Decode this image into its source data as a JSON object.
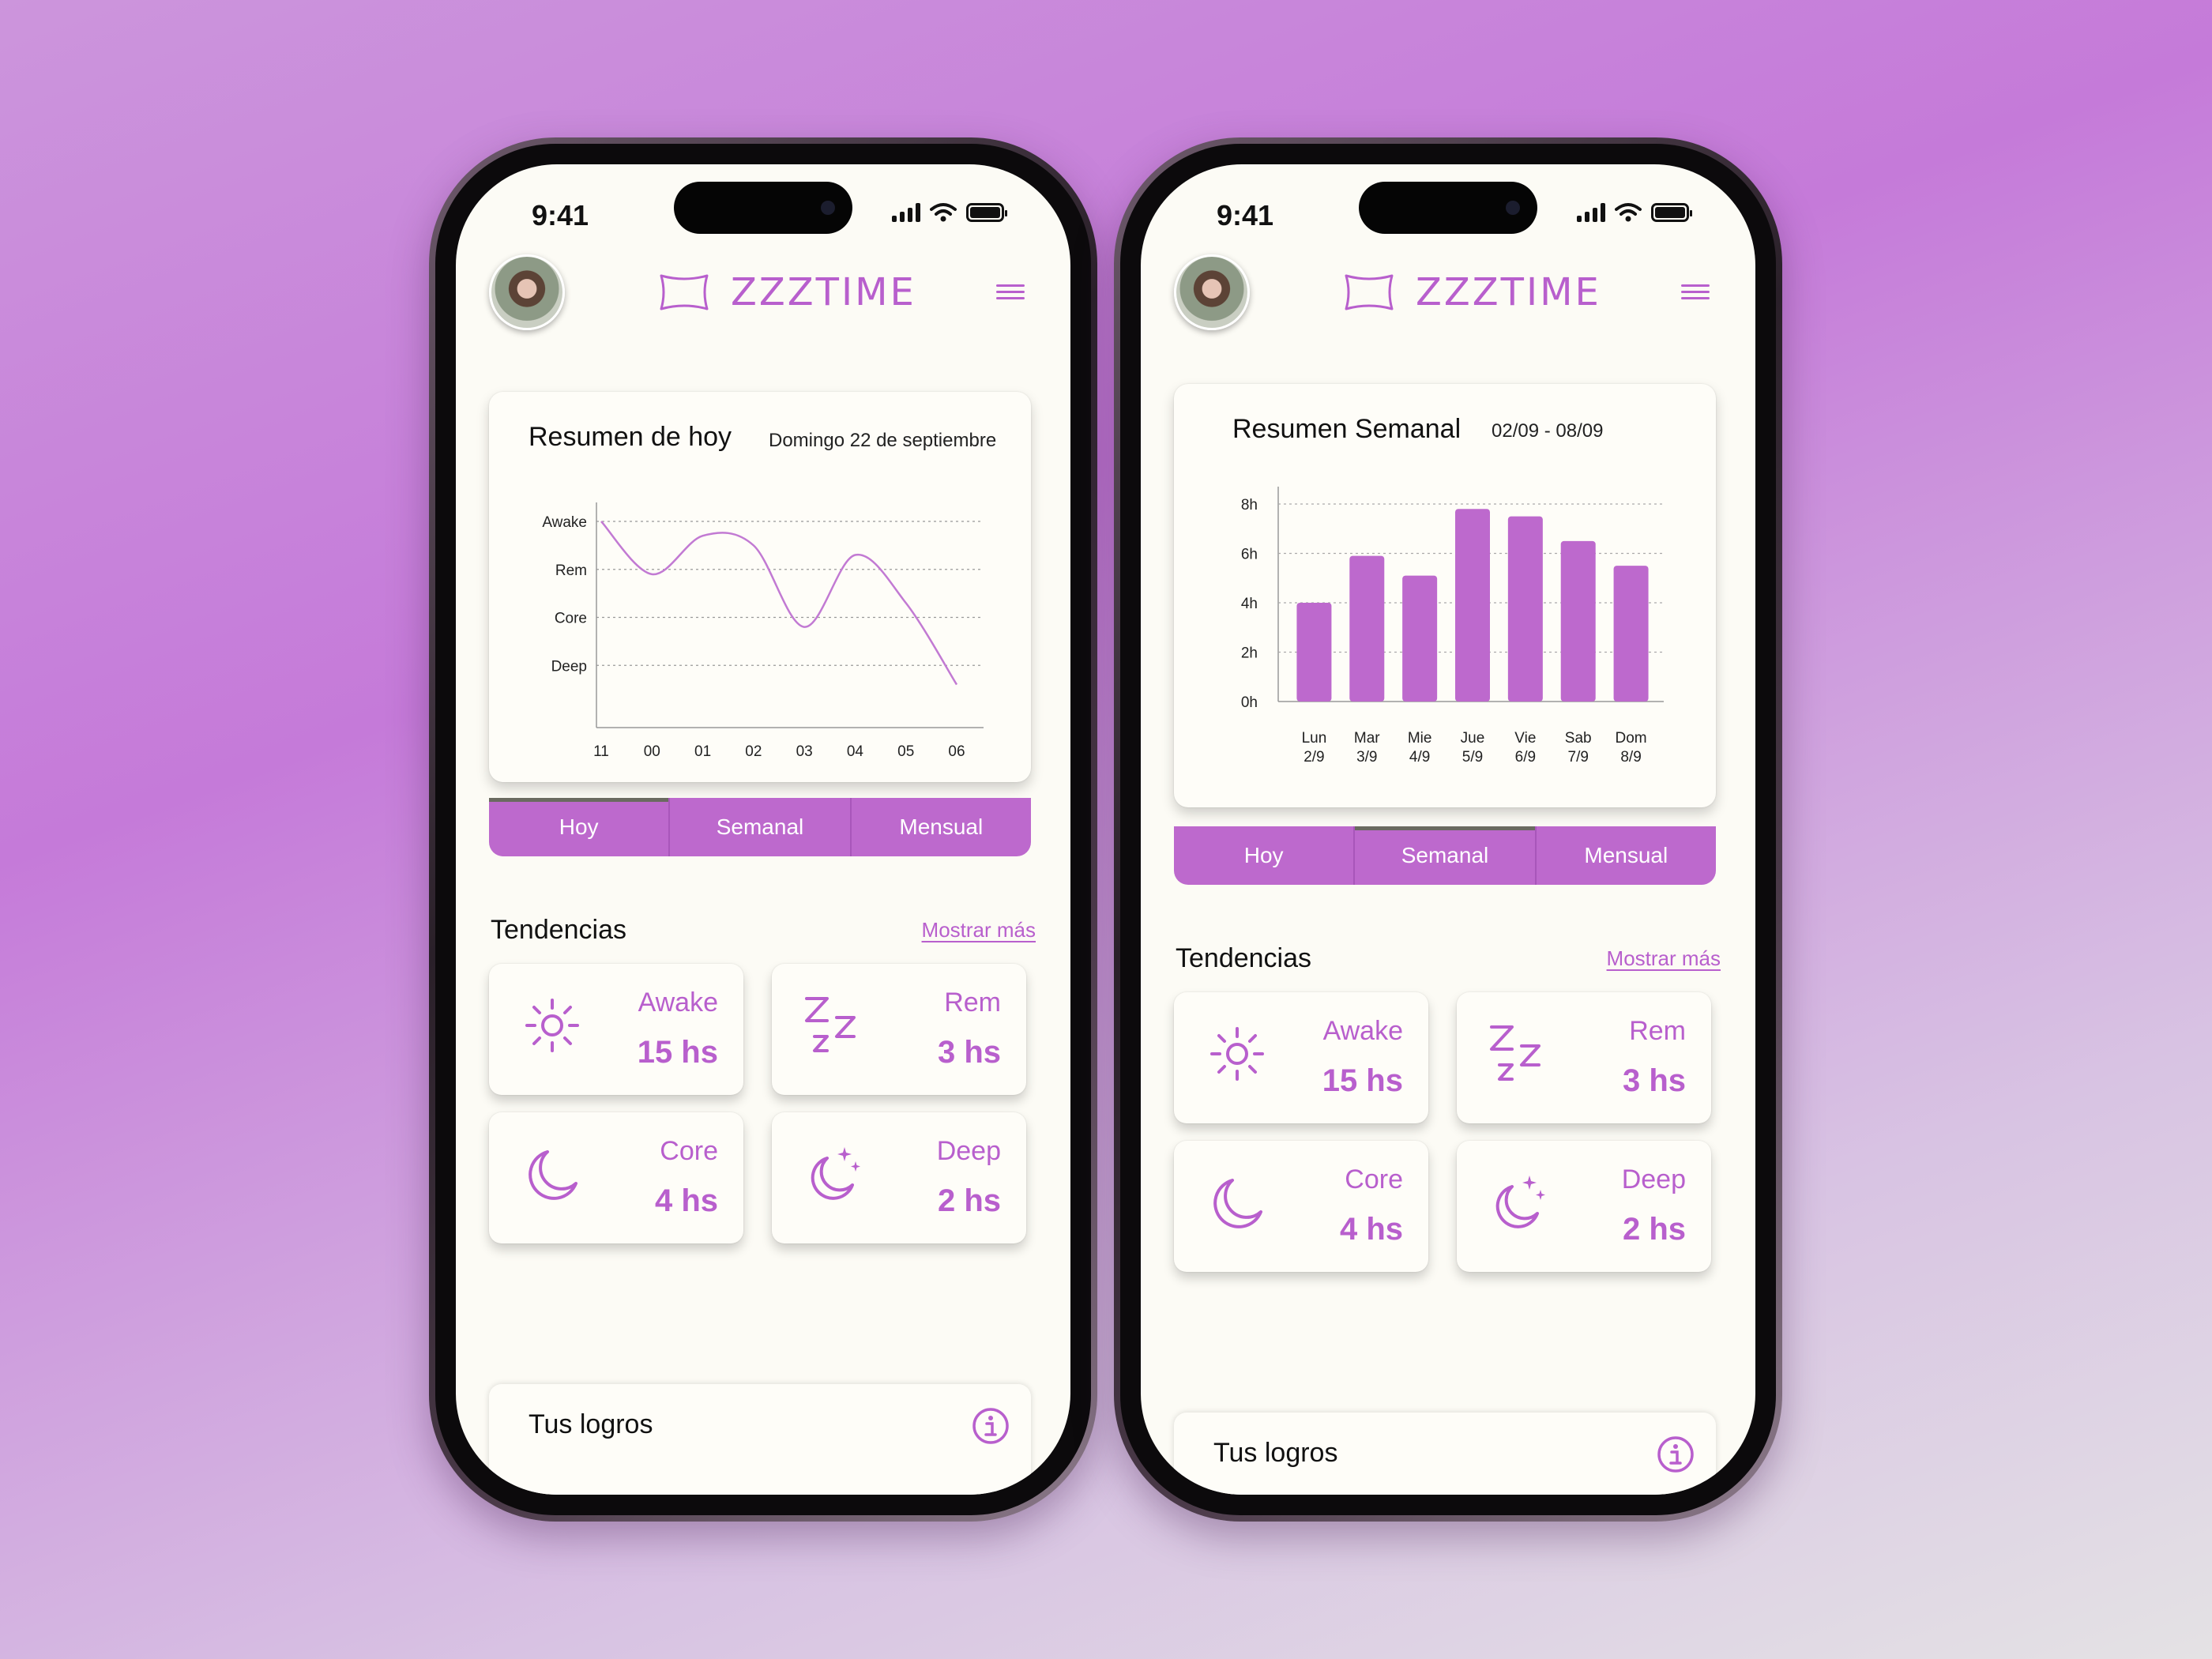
{
  "colors": {
    "accent": "#bd69cd",
    "accent_text": "#b85fcd",
    "screen_bg": "#fcfbf5"
  },
  "phones": [
    {
      "status": {
        "time": "9:41"
      },
      "header": {
        "app_name": "ZZZTIME",
        "logo_icon": "pillow-icon",
        "menu_icon": "hamburger-menu-icon"
      },
      "summary": {
        "title": "Resumen de hoy",
        "date": "Domingo 22 de septiembre"
      },
      "tabs": [
        {
          "label": "Hoy",
          "active": true
        },
        {
          "label": "Semanal",
          "active": false
        },
        {
          "label": "Mensual",
          "active": false
        }
      ],
      "trends": {
        "title": "Tendencias",
        "show_more": "Mostrar más",
        "items": [
          {
            "icon": "sun-icon",
            "label": "Awake",
            "value": "15 hs"
          },
          {
            "icon": "zzz-icon",
            "label": "Rem",
            "value": "3 hs"
          },
          {
            "icon": "moon-icon",
            "label": "Core",
            "value": "4 hs"
          },
          {
            "icon": "moon-stars-icon",
            "label": "Deep",
            "value": "2 hs"
          }
        ]
      },
      "achievements": {
        "title": "Tus logros",
        "icon": "info-icon"
      }
    },
    {
      "status": {
        "time": "9:41"
      },
      "header": {
        "app_name": "ZZZTIME",
        "logo_icon": "pillow-icon",
        "menu_icon": "hamburger-menu-icon"
      },
      "summary": {
        "title": "Resumen Semanal",
        "date": "02/09 - 08/09"
      },
      "tabs": [
        {
          "label": "Hoy",
          "active": false
        },
        {
          "label": "Semanal",
          "active": true
        },
        {
          "label": "Mensual",
          "active": false
        }
      ],
      "trends": {
        "title": "Tendencias",
        "show_more": "Mostrar más",
        "items": [
          {
            "icon": "sun-icon",
            "label": "Awake",
            "value": "15 hs"
          },
          {
            "icon": "zzz-icon",
            "label": "Rem",
            "value": "3 hs"
          },
          {
            "icon": "moon-icon",
            "label": "Core",
            "value": "4 hs"
          },
          {
            "icon": "moon-stars-icon",
            "label": "Deep",
            "value": "2 hs"
          }
        ]
      },
      "achievements": {
        "title": "Tus logros",
        "icon": "info-icon"
      }
    }
  ],
  "chart_data": [
    {
      "type": "line",
      "title": "Resumen de hoy",
      "x": [
        "11",
        "00",
        "01",
        "02",
        "03",
        "04",
        "05",
        "06"
      ],
      "y_categories": [
        "Awake",
        "Rem",
        "Core",
        "Deep"
      ],
      "series": [
        {
          "values": [
            3.0,
            1.9,
            2.7,
            2.5,
            0.8,
            2.3,
            1.3,
            -0.4
          ]
        }
      ],
      "grid": true
    },
    {
      "type": "bar",
      "title": "Resumen Semanal",
      "categories": [
        "Lun 2/9",
        "Mar 3/9",
        "Mie 4/9",
        "Jue 5/9",
        "Vie 6/9",
        "Sab 7/9",
        "Dom 8/9"
      ],
      "values": [
        4.0,
        5.9,
        5.1,
        7.8,
        7.5,
        6.5,
        5.5
      ],
      "yticks": [
        "0h",
        "2h",
        "4h",
        "6h",
        "8h"
      ],
      "ylim": [
        0,
        8
      ],
      "grid": true
    }
  ]
}
